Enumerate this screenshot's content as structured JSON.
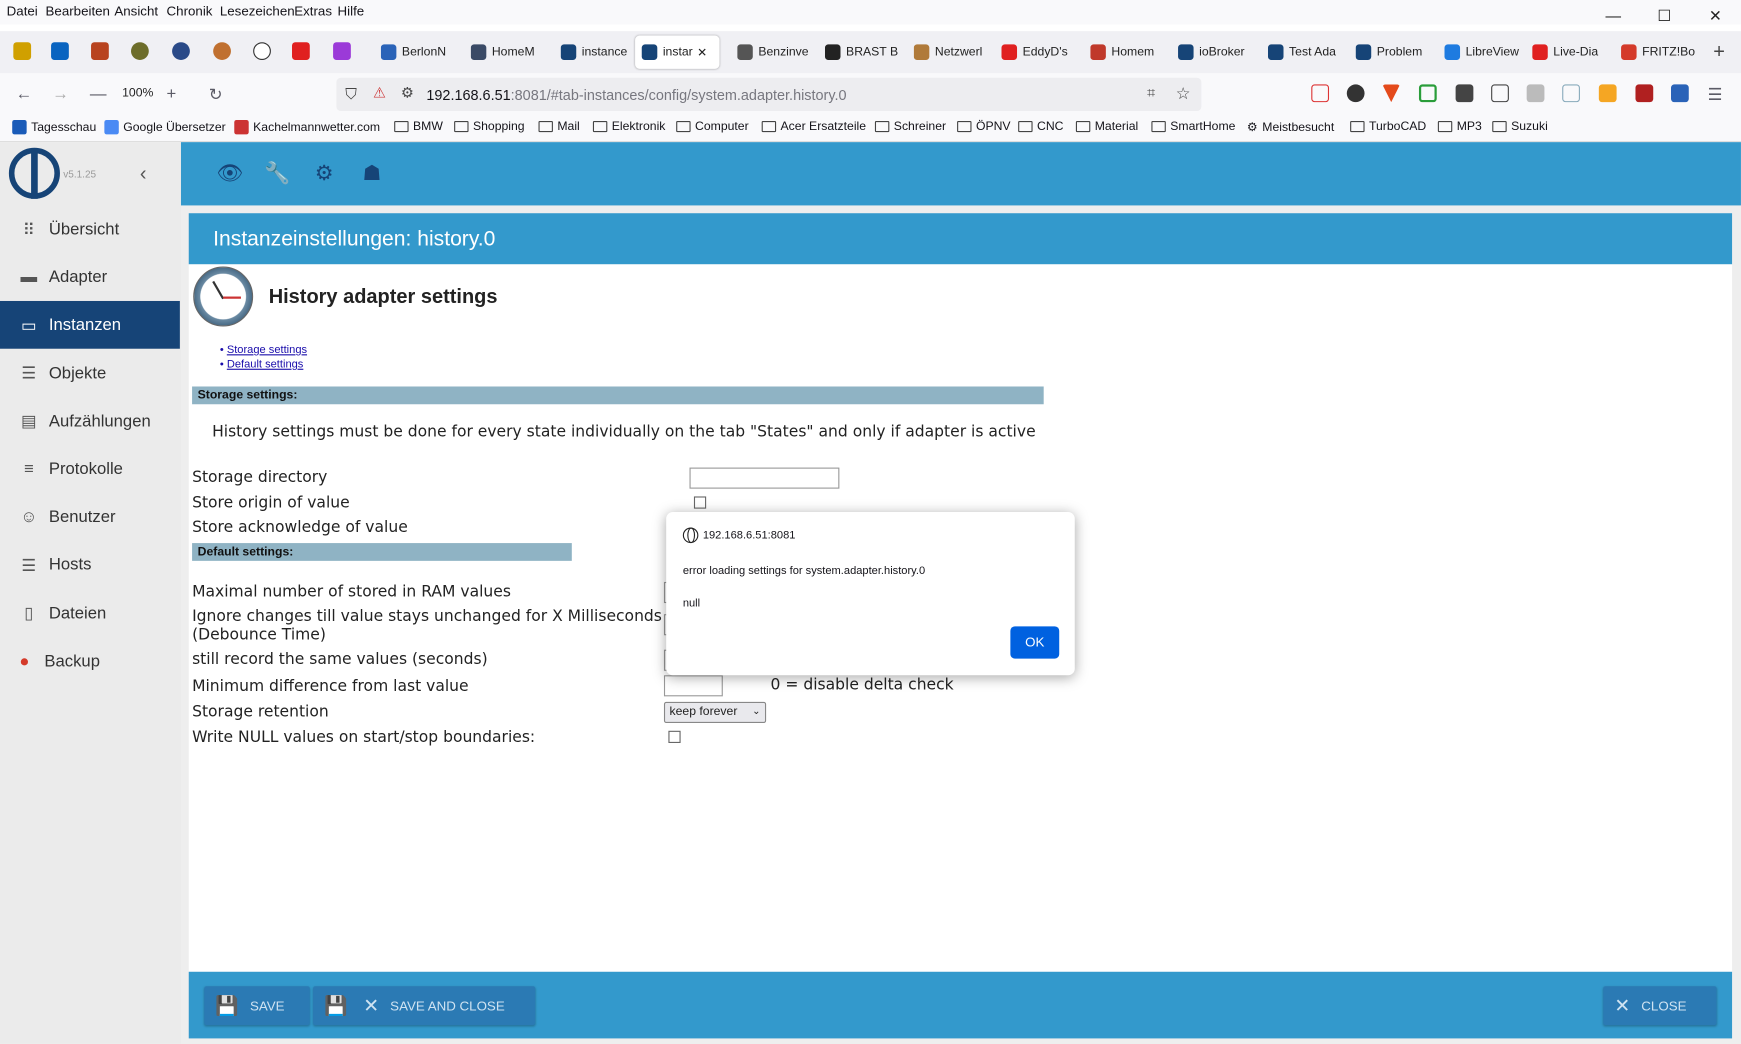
{
  "menubar": {
    "items": [
      "Datei",
      "Bearbeiten",
      "Ansicht",
      "Chronik",
      "Lesezeichen",
      "Extras",
      "Hilfe"
    ]
  },
  "tabs": [
    {
      "label": "BerlonN",
      "color": "#2a63b8"
    },
    {
      "label": "HomeM",
      "color": "#3a4a66"
    },
    {
      "label": "instance",
      "color": "#164477"
    },
    {
      "label": "instar",
      "color": "#164477",
      "active": true
    },
    {
      "label": "Benzinve",
      "color": "#555555"
    },
    {
      "label": "BRAST B",
      "color": "#222222"
    },
    {
      "label": "Netzwerl",
      "color": "#b07a3a"
    },
    {
      "label": "EddyD's",
      "color": "#e02020"
    },
    {
      "label": "Homem",
      "color": "#c0392b"
    },
    {
      "label": "ioBroker",
      "color": "#164477"
    },
    {
      "label": "Test Ada",
      "color": "#164477"
    },
    {
      "label": "Problem",
      "color": "#164477"
    },
    {
      "label": "LibreView",
      "color": "#1e7be0"
    },
    {
      "label": "Live-Dia",
      "color": "#e02020"
    },
    {
      "label": "FRITZ!Bo",
      "color": "#d43a2a"
    }
  ],
  "nav": {
    "zoom": "100%",
    "url_host": "192.168.6.51",
    "url_rest": ":8081/#tab-instances/config/system.adapter.history.0"
  },
  "bookmarks": [
    "Tagesschau",
    "Google Übersetzer",
    "Kachelmannwetter.com",
    "BMW",
    "Shopping",
    "Mail",
    "Elektronik",
    "Computer",
    "Acer Ersatzteile",
    "Schreiner",
    "ÖPNV",
    "CNC",
    "Material",
    "SmartHome",
    "Meistbesucht",
    "TurboCAD",
    "MP3",
    "Suzuki"
  ],
  "sidebar": {
    "version": "v5.1.25",
    "items": [
      {
        "label": "Übersicht",
        "icon": "grid-icon"
      },
      {
        "label": "Adapter",
        "icon": "store-icon"
      },
      {
        "label": "Instanzen",
        "icon": "instances-icon",
        "active": true
      },
      {
        "label": "Objekte",
        "icon": "list-icon"
      },
      {
        "label": "Aufzählungen",
        "icon": "enum-icon"
      },
      {
        "label": "Protokolle",
        "icon": "log-icon"
      },
      {
        "label": "Benutzer",
        "icon": "user-icon"
      },
      {
        "label": "Hosts",
        "icon": "hosts-icon"
      },
      {
        "label": "Dateien",
        "icon": "file-icon"
      },
      {
        "label": "Backup",
        "icon": "backup-icon"
      }
    ]
  },
  "page": {
    "title": "Instanzeinstellungen: history.0"
  },
  "settings": {
    "heading": "History adapter settings",
    "toc": [
      "Storage settings",
      "Default settings"
    ],
    "storage_header": "Storage settings:",
    "info": "History settings must be done for every state individually on the tab \"States\" and only if adapter is active",
    "storage_directory": "Storage directory",
    "store_origin": "Store origin of value",
    "store_ack": "Store acknowledge of value",
    "default_header": "Default settings:",
    "max_ram": "Maximal number of stored in RAM values",
    "debounce_1": "Ignore changes till value stays unchanged for X Milliseconds",
    "debounce_2": "(Debounce Time)",
    "still_record": "still record the same values (seconds)",
    "min_diff": "Minimum difference from last value",
    "delta_hint": "0 = disable delta check",
    "retention_label": "Storage retention",
    "retention_value": "keep forever",
    "write_null": "Write NULL values on start/stop boundaries:"
  },
  "footer": {
    "save": "SAVE",
    "save_close": "SAVE AND CLOSE",
    "close": "CLOSE"
  },
  "dialog": {
    "host": "192.168.6.51:8081",
    "message": "error loading settings for system.adapter.history.0",
    "detail": "null",
    "ok": "OK"
  }
}
